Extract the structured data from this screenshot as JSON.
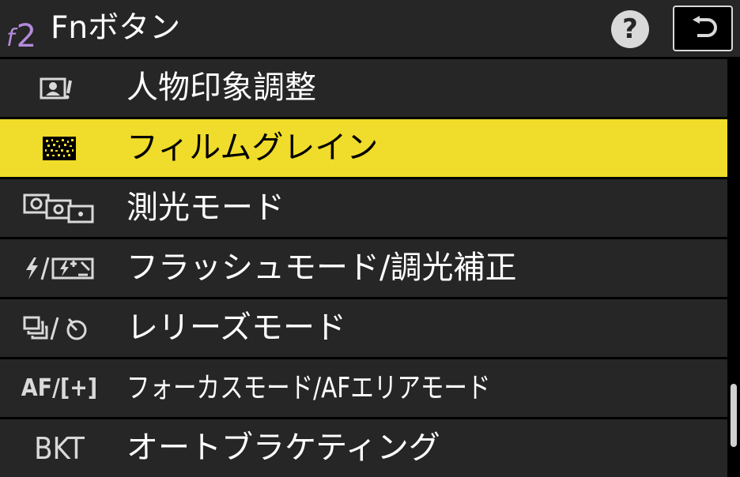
{
  "header": {
    "menu_code_letter": "f",
    "menu_code_number": "2",
    "title": "Fnボタン",
    "help_label": "?",
    "back_icon": "return-arrow-icon"
  },
  "colors": {
    "header_bg": "#262626",
    "row_bg": "#262626",
    "selected_bg": "#f0dc2a",
    "menu_code": "#b48bdc",
    "text": "#ffffff",
    "selected_text": "#000000"
  },
  "items": [
    {
      "label": "人物印象調整",
      "icon": "portrait-impression-icon",
      "selected": false
    },
    {
      "label": "フィルムグレイン",
      "icon": "film-grain-icon",
      "selected": true
    },
    {
      "label": "測光モード",
      "icon": "metering-mode-icon",
      "selected": false
    },
    {
      "label": "フラッシュモード/調光補正",
      "icon": "flash-mode-icon",
      "selected": false
    },
    {
      "label": "レリーズモード",
      "icon": "release-mode-icon",
      "selected": false
    },
    {
      "label": "フォーカスモード/AFエリアモード",
      "icon": "af-mode-icon",
      "icon_text": "AF/[+]",
      "selected": false
    },
    {
      "label": "オートブラケティング",
      "icon": "bracketing-icon",
      "icon_text": "BKT",
      "selected": false
    }
  ],
  "scroll": {
    "position": 0.92
  }
}
